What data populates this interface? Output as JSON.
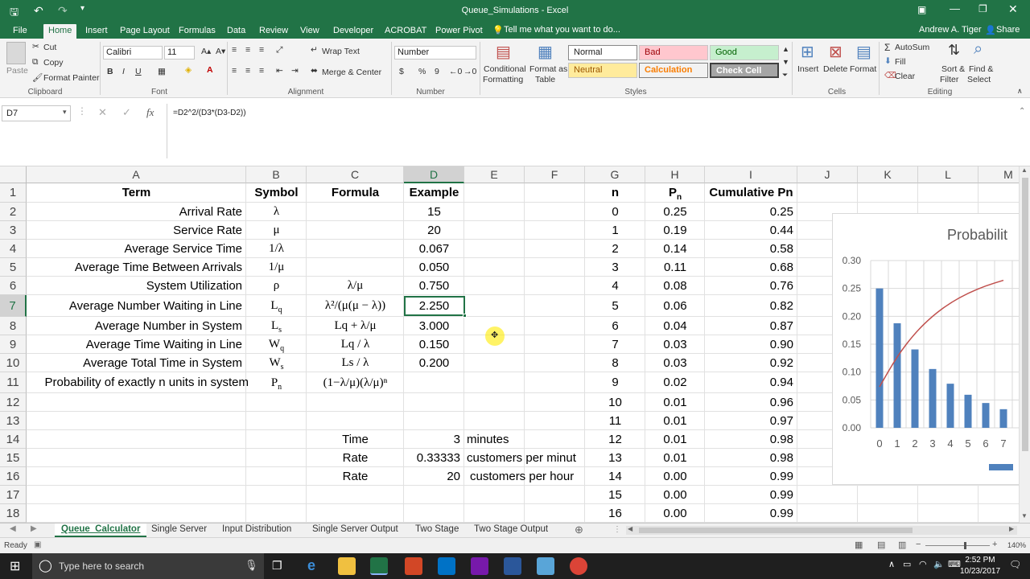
{
  "window": {
    "title": "Queue_Simulations - Excel",
    "user": "Andrew A. Tiger",
    "share": "Share"
  },
  "ribbon_tabs": [
    "File",
    "Home",
    "Insert",
    "Page Layout",
    "Formulas",
    "Data",
    "Review",
    "View",
    "Developer",
    "ACROBAT",
    "Power Pivot"
  ],
  "tell_me": "Tell me what you want to do...",
  "clipboard": {
    "paste": "Paste",
    "cut": "Cut",
    "copy": "Copy",
    "format_painter": "Format Painter",
    "label": "Clipboard"
  },
  "font": {
    "name": "Calibri",
    "size": "11",
    "bold": "B",
    "italic": "I",
    "underline": "U",
    "label": "Font"
  },
  "alignment": {
    "wrap": "Wrap Text",
    "merge": "Merge & Center",
    "label": "Alignment"
  },
  "number": {
    "format": "Number",
    "currency": "$",
    "percent": "%",
    "comma": "9",
    "label": "Number"
  },
  "styles": {
    "conditional": "Conditional",
    "formatting": "Formatting",
    "format_as": "Format as",
    "table": "Table",
    "normal": "Normal",
    "bad": "Bad",
    "good": "Good",
    "neutral": "Neutral",
    "calculation": "Calculation",
    "check_cell": "Check Cell",
    "label": "Styles"
  },
  "cells": {
    "insert": "Insert",
    "delete": "Delete",
    "format": "Format",
    "label": "Cells"
  },
  "editing": {
    "autosum": "AutoSum",
    "fill": "Fill",
    "clear": "Clear",
    "sort": "Sort &",
    "filter": "Filter",
    "find": "Find &",
    "select": "Select",
    "label": "Editing"
  },
  "formula_bar": {
    "name_box": "D7",
    "fx": "fx",
    "formula": "=D2^2/(D3*(D3-D2))"
  },
  "columns": [
    "A",
    "B",
    "C",
    "D",
    "E",
    "F",
    "G",
    "H",
    "I",
    "J",
    "K",
    "L",
    "M"
  ],
  "rows": [
    "1",
    "2",
    "3",
    "4",
    "5",
    "6",
    "7",
    "8",
    "9",
    "10",
    "11",
    "12",
    "13",
    "14",
    "15",
    "16",
    "17",
    "18"
  ],
  "table": {
    "headers": {
      "term": "Term",
      "symbol": "Symbol",
      "formula": "Formula",
      "example": "Example",
      "n": "n",
      "pn": "P",
      "pn_sub": "n",
      "cum": "Cumulative  Pn"
    },
    "terms": [
      "Arrival Rate",
      "Service Rate",
      "Average Service Time",
      "Average Time Between Arrivals",
      "System Utilization",
      "Average Number Waiting in Line",
      "Average Number in System",
      "Average Time Waiting in Line",
      "Average Total Time in System",
      "Probability of exactly n units in system"
    ],
    "symbols": [
      "λ",
      "μ",
      "1/λ",
      "1/μ",
      "ρ",
      "L",
      "L",
      "W",
      "W",
      "P"
    ],
    "symbol_subs": [
      "",
      "",
      "",
      "",
      "",
      "q",
      "s",
      "q",
      "s",
      "n"
    ],
    "formulas": [
      "",
      "",
      "",
      "",
      "λ/μ",
      "λ²/(μ(μ − λ))",
      "Lq + λ/μ",
      "Lq / λ",
      "Ls / λ",
      "(1−λ/μ)(λ/μ)ⁿ"
    ],
    "examples": [
      "15",
      "20",
      "0.067",
      "0.050",
      "0.750",
      "2.250",
      "3.000",
      "0.150",
      "0.200",
      ""
    ],
    "calc": [
      {
        "label": "Time",
        "value": "3",
        "unit": "minutes"
      },
      {
        "label": "Rate",
        "value": "0.33333",
        "unit": "customers per minut"
      },
      {
        "label": "Rate",
        "value": "20",
        "unit": "customers per hour"
      }
    ],
    "n_values": [
      "0",
      "1",
      "2",
      "3",
      "4",
      "5",
      "6",
      "7",
      "8",
      "9",
      "10",
      "11",
      "12",
      "13",
      "14",
      "15",
      "16"
    ],
    "pn_values": [
      "0.25",
      "0.19",
      "0.14",
      "0.11",
      "0.08",
      "0.06",
      "0.04",
      "0.03",
      "0.03",
      "0.02",
      "0.01",
      "0.01",
      "0.01",
      "0.01",
      "0.00",
      "0.00",
      "0.00"
    ],
    "cum_values": [
      "0.25",
      "0.44",
      "0.58",
      "0.68",
      "0.76",
      "0.82",
      "0.87",
      "0.90",
      "0.92",
      "0.94",
      "0.96",
      "0.97",
      "0.98",
      "0.98",
      "0.99",
      "0.99",
      "0.99"
    ]
  },
  "chart_data": {
    "type": "bar",
    "title": "Probabilit",
    "categories": [
      "0",
      "1",
      "2",
      "3",
      "4",
      "5",
      "6",
      "7"
    ],
    "series": [
      {
        "values": [
          0.25,
          0.1875,
          0.1406,
          0.1055,
          0.0791,
          0.0593,
          0.0445,
          0.0334
        ]
      },
      {
        "values": [
          0.25,
          0.4375,
          0.5781,
          0.6836,
          0.7627,
          0.822,
          0.8665,
          0.8999
        ]
      }
    ],
    "ylim": [
      0,
      0.3
    ],
    "yticks": [
      "0.00",
      "0.05",
      "0.10",
      "0.15",
      "0.20",
      "0.25",
      "0.30"
    ],
    "colors": {
      "bar": "#4f81bd",
      "line": "#c0504d"
    }
  },
  "sheet_tabs": [
    "Queue_Calculator",
    "Single Server",
    "Input Distribution",
    "Single Server Output",
    "Two Stage",
    "Two Stage Output"
  ],
  "status": {
    "ready": "Ready",
    "zoom": "140%"
  },
  "taskbar": {
    "search": "Type here to search",
    "time": "2:52 PM",
    "date": "10/23/2017"
  }
}
